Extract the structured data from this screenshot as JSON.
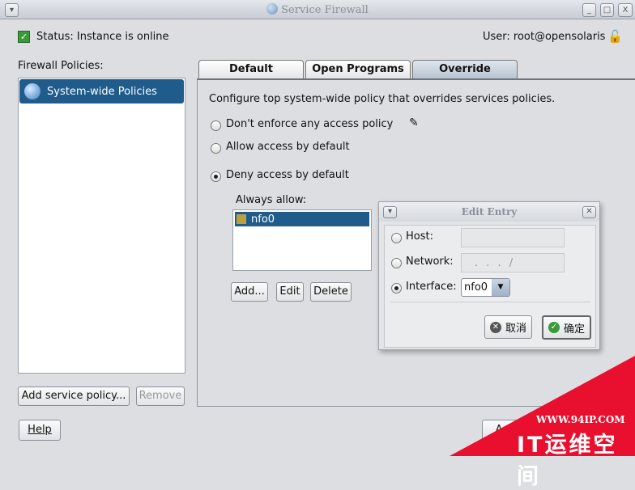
{
  "window": {
    "title": "Service Firewall"
  },
  "status": {
    "text": "Status: Instance is online",
    "user": "User: root@opensolaris"
  },
  "sidebar": {
    "label": "Firewall Policies:",
    "items": [
      {
        "label": "System-wide Policies",
        "selected": true
      }
    ],
    "add_button": "Add service policy...",
    "remove_button": "Remove"
  },
  "tabs": [
    {
      "label": "Default"
    },
    {
      "label": "Open Programs"
    },
    {
      "label": "Override",
      "active": true
    }
  ],
  "override": {
    "description": "Configure top system-wide policy that overrides services policies.",
    "options": [
      {
        "label": "Don't enforce any access policy",
        "selected": false
      },
      {
        "label": "Allow access by default",
        "selected": false
      },
      {
        "label": "Deny access by default",
        "selected": true
      }
    ],
    "always_allow_label": "Always allow:",
    "always_allow_items": [
      {
        "label": "nfo0",
        "selected": true
      }
    ],
    "add_button": "Add...",
    "edit_button": "Edit",
    "delete_button": "Delete"
  },
  "dialog": {
    "title": "Edit Entry",
    "host_label": "Host:",
    "host_value": "",
    "network_label": "Network:",
    "network_value": ". . . /",
    "interface_label": "Interface:",
    "interface_value": "nfo0",
    "selected_option": "Interface",
    "cancel_button": "取消",
    "ok_button": "确定"
  },
  "footer": {
    "help_button": "Help",
    "apply_button": "Apply"
  },
  "watermark": {
    "url": "WWW.94IP.COM",
    "name": "IT运维空间"
  },
  "colors": {
    "selection": "#1f5c8c",
    "watermark": "#e8102e"
  }
}
